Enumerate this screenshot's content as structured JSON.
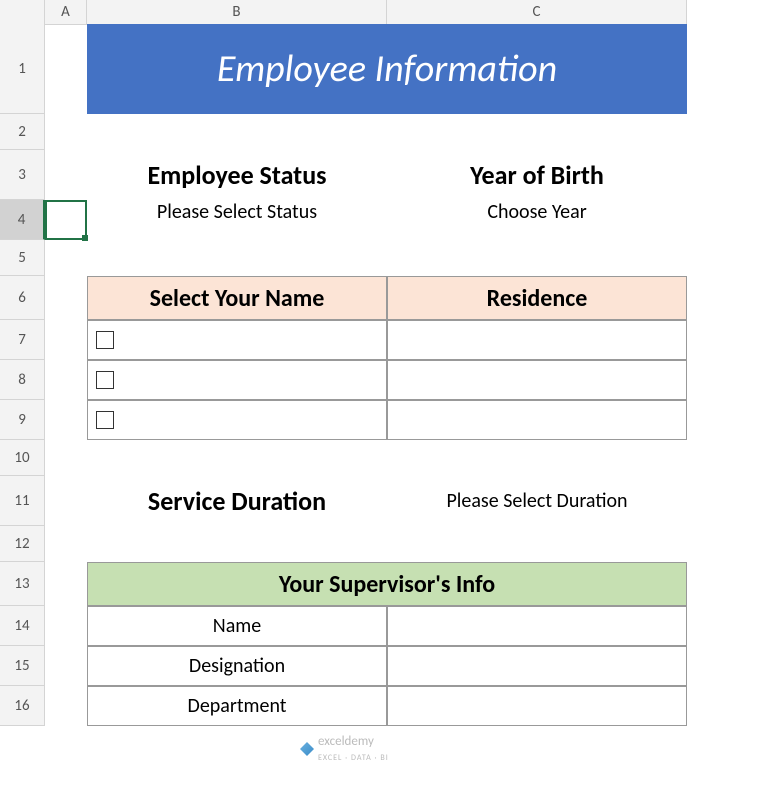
{
  "columns": [
    "A",
    "B",
    "C"
  ],
  "rows": [
    "1",
    "2",
    "3",
    "4",
    "5",
    "6",
    "7",
    "8",
    "9",
    "10",
    "11",
    "12",
    "13",
    "14",
    "15",
    "16"
  ],
  "selected_row": "4",
  "title": "Employee Information",
  "section1": {
    "col_b_heading": "Employee Status",
    "col_b_sub": "Please Select Status",
    "col_c_heading": "Year of Birth",
    "col_c_sub": "Choose Year"
  },
  "table1": {
    "header_b": "Select Your Name",
    "header_c": "Residence",
    "rows": [
      {
        "name": "",
        "residence": ""
      },
      {
        "name": "",
        "residence": ""
      },
      {
        "name": "",
        "residence": ""
      }
    ]
  },
  "section2": {
    "col_b_heading": "Service Duration",
    "col_c_text": "Please Select Duration"
  },
  "table2": {
    "header": "Your Supervisor's Info",
    "rows": [
      {
        "label": "Name",
        "value": ""
      },
      {
        "label": "Designation",
        "value": ""
      },
      {
        "label": "Department",
        "value": ""
      }
    ]
  },
  "watermark": {
    "brand": "exceldemy",
    "tagline": "EXCEL · DATA · BI"
  }
}
